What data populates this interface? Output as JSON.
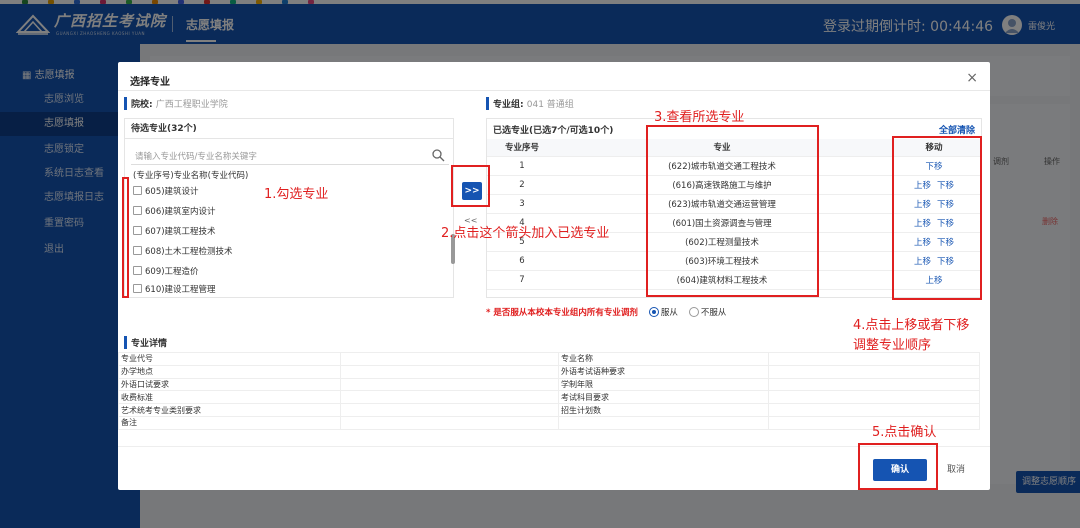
{
  "colors": {
    "brand": "#1554b2",
    "annotation": "#e02020"
  },
  "topstrip_colors": [
    "#2b8a3e",
    "#e8a100",
    "#2f6fdb",
    "#d6336c",
    "#37b24d",
    "#f08c00",
    "#4263eb",
    "#e03131",
    "#12b886",
    "#fab005",
    "#1c7ed6",
    "#e64980"
  ],
  "header": {
    "logo_text": "广西招生考试院",
    "logo_sub": "GUANGXI ZHAOSHENG KAOSHI YUAN",
    "nav_title": "志愿填报",
    "countdown": "登录过期倒计时: 00:44:46",
    "username": "雷俊光"
  },
  "sidebar": {
    "head": "志愿填报",
    "items": [
      {
        "label": "志愿浏览"
      },
      {
        "label": "志愿填报",
        "active": true
      },
      {
        "label": "志愿锁定"
      },
      {
        "label": "系统日志查看"
      },
      {
        "label": "志愿填报日志"
      },
      {
        "label": "重置密码"
      },
      {
        "label": "退出"
      }
    ]
  },
  "background": {
    "col_adjust": "调剂",
    "col_ops": "操作",
    "delete": "删除",
    "adjust_order_btn": "调整志愿顺序"
  },
  "modal": {
    "title": "选择专业",
    "close": "×",
    "school_label": "院校:",
    "school_value": "广西工程职业学院",
    "group_label": "专业组:",
    "group_value": "041 普通组",
    "candidates_head": "待选专业(32个)",
    "search_placeholder": "请输入专业代码/专业名称关键字",
    "candidates_col": "(专业序号)专业名称(专业代码)",
    "candidates": [
      {
        "label": "605)建筑设计"
      },
      {
        "label": "606)建筑室内设计"
      },
      {
        "label": "607)建筑工程技术"
      },
      {
        "label": "608)土木工程检测技术"
      },
      {
        "label": "609)工程造价"
      },
      {
        "label": "610)建设工程管理"
      }
    ],
    "add_button": ">>",
    "remove_button": "<<",
    "selected_head": "已选专业(已选7个/可选10个)",
    "clear_all": "全部清除",
    "selected_cols": {
      "seq": "专业序号",
      "major": "专业",
      "move": "移动"
    },
    "move_up": "上移",
    "move_down": "下移",
    "selected": [
      {
        "seq": "1",
        "major": "(622)城市轨道交通工程技术",
        "up": false,
        "down": true
      },
      {
        "seq": "2",
        "major": "(616)高速铁路施工与维护",
        "up": true,
        "down": true
      },
      {
        "seq": "3",
        "major": "(623)城市轨道交通运营管理",
        "up": true,
        "down": true
      },
      {
        "seq": "4",
        "major": "(601)国土资源调查与管理",
        "up": true,
        "down": true
      },
      {
        "seq": "5",
        "major": "(602)工程测量技术",
        "up": true,
        "down": true
      },
      {
        "seq": "6",
        "major": "(603)环境工程技术",
        "up": true,
        "down": true
      },
      {
        "seq": "7",
        "major": "(604)建筑材料工程技术",
        "up": true,
        "down": false
      }
    ],
    "adjust_question": "* 是否服从本校本专业组内所有专业调剂",
    "adjust_yes": "服从",
    "adjust_no": "不服从",
    "details_title": "专业详情",
    "details": [
      [
        "专业代号",
        "专业名称"
      ],
      [
        "办学地点",
        "外语考试语种要求"
      ],
      [
        "外语口试要求",
        "学制年限"
      ],
      [
        "收费标准",
        "考试科目要求"
      ],
      [
        "艺术统考专业类别要求",
        "招生计划数"
      ],
      [
        "备注",
        ""
      ]
    ],
    "confirm": "确认",
    "cancel": "取消"
  },
  "annotations": {
    "a1": "1.勾选专业",
    "a2": "2.点击这个箭头加入已选专业",
    "a3": "3.查看所选专业",
    "a4": "4.点击上移或者下移",
    "a4b": "调整专业顺序",
    "a5": "5.点击确认"
  }
}
